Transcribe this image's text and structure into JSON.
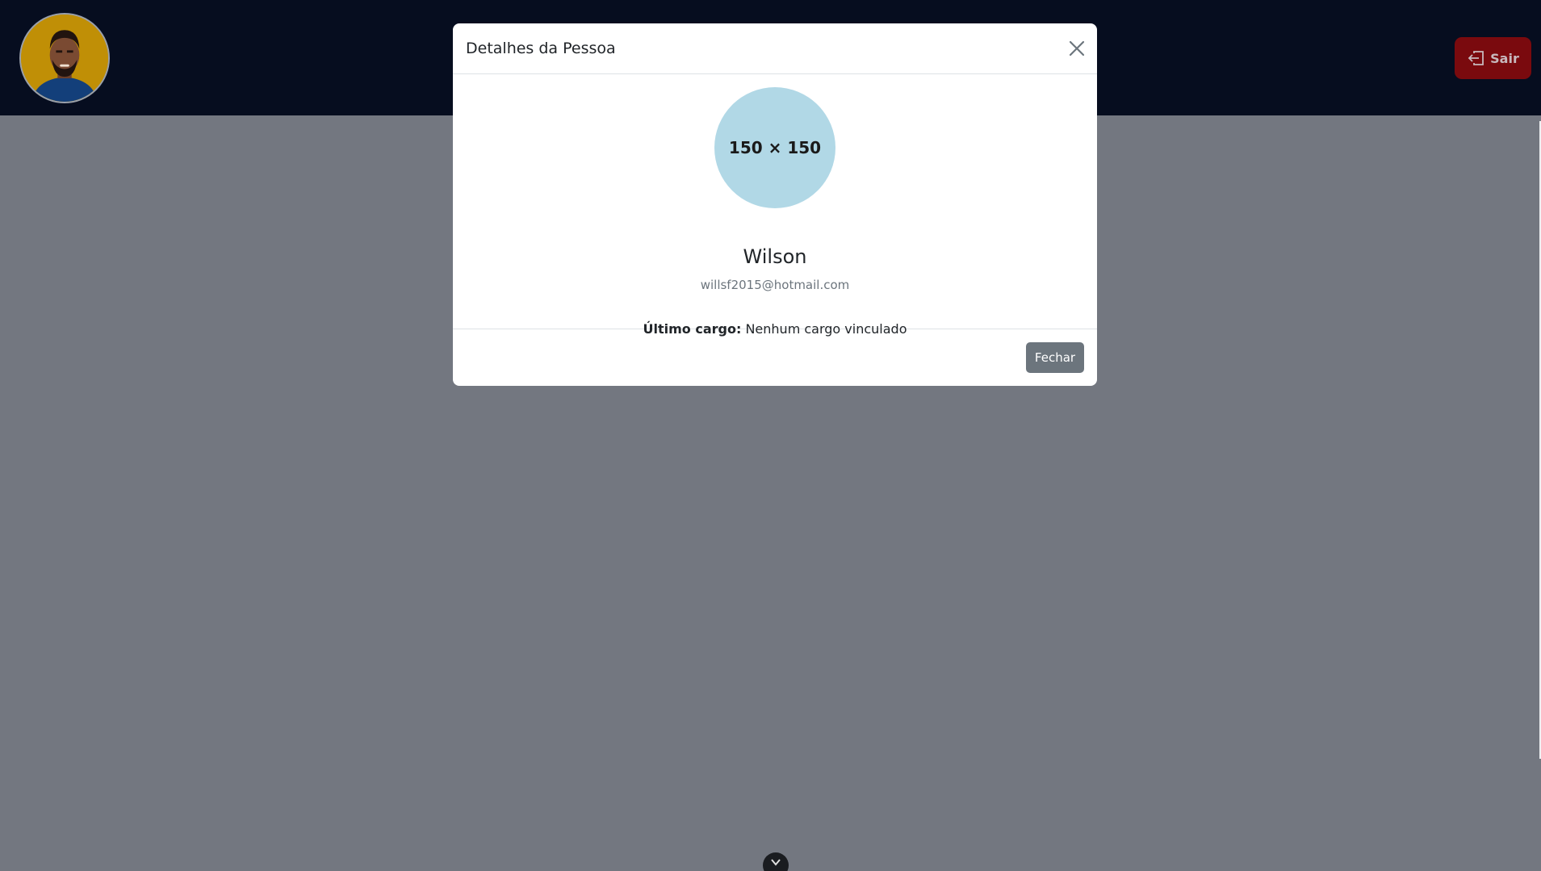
{
  "header": {
    "logout_label": "Sair"
  },
  "modal": {
    "title": "Detalhes da Pessoa",
    "photo_placeholder": "150 × 150",
    "name": "Wilson",
    "email": "willsf2015@hotmail.com",
    "last_role_label": "Último cargo:",
    "last_role_value": "Nenhum cargo vinculado",
    "close_button": "Fechar"
  },
  "colors": {
    "header_bg": "#060d1f",
    "backdrop": "#737780",
    "logout_bg": "#7a0a0e",
    "photo_bg": "#b1d8e6",
    "secondary_button": "#6c757d"
  },
  "icons": {
    "avatar": "user-avatar-illustration",
    "logout": "box-arrow-left-icon",
    "close": "close-icon",
    "scroll": "chevron-down-icon"
  }
}
